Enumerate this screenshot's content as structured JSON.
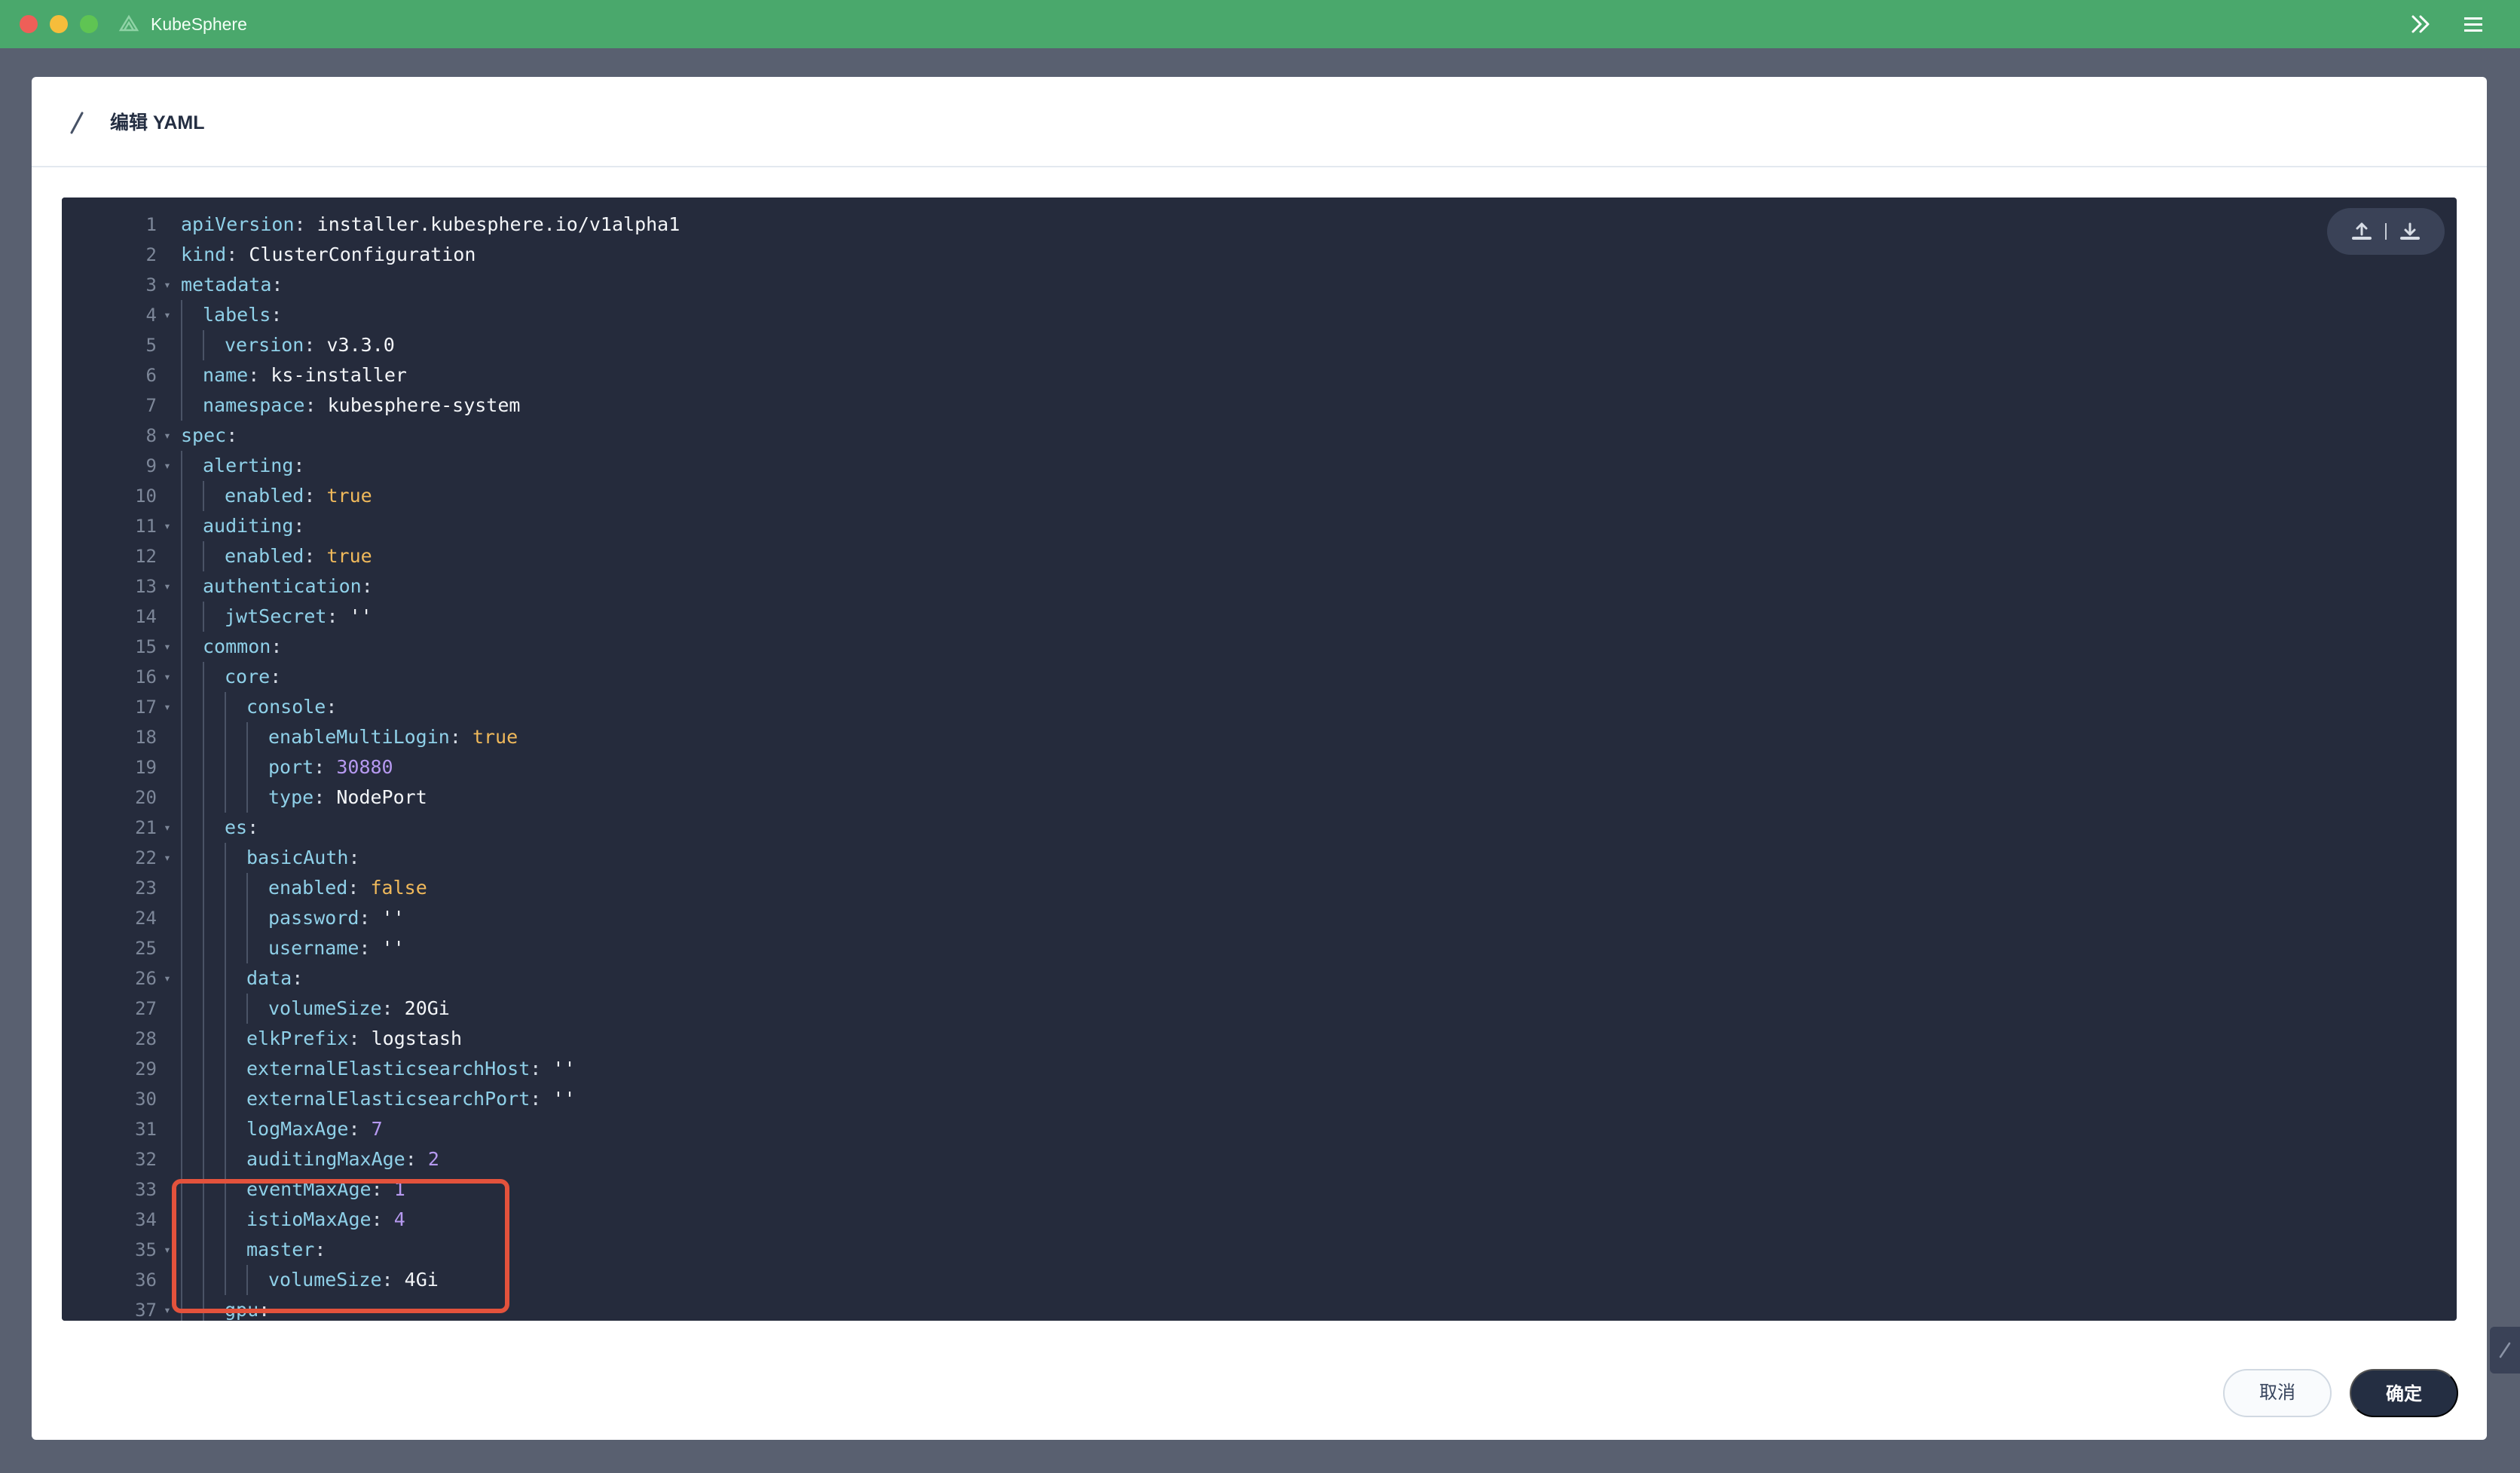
{
  "window": {
    "title": "KubeSphere",
    "accent_color": "#4aa86c"
  },
  "modal": {
    "title": "编辑 YAML",
    "cancel_label": "取消",
    "confirm_label": "确定"
  },
  "editor": {
    "upload_icon": "upload-icon",
    "download_icon": "download-icon",
    "highlight_color": "#e3523c",
    "highlighted_lines": [
      31,
      32,
      33,
      34
    ],
    "lines": [
      {
        "n": "1",
        "fold": false,
        "depth": 0,
        "key": "apiVersion",
        "value": "installer.kubesphere.io/v1alpha1",
        "type": "s"
      },
      {
        "n": "2",
        "fold": false,
        "depth": 0,
        "key": "kind",
        "value": "ClusterConfiguration",
        "type": "s"
      },
      {
        "n": "3",
        "fold": true,
        "depth": 0,
        "key": "metadata",
        "value": "",
        "type": "s"
      },
      {
        "n": "4",
        "fold": true,
        "depth": 1,
        "key": "labels",
        "value": "",
        "type": "s"
      },
      {
        "n": "5",
        "fold": false,
        "depth": 2,
        "key": "version",
        "value": "v3.3.0",
        "type": "s"
      },
      {
        "n": "6",
        "fold": false,
        "depth": 1,
        "key": "name",
        "value": "ks-installer",
        "type": "s"
      },
      {
        "n": "7",
        "fold": false,
        "depth": 1,
        "key": "namespace",
        "value": "kubesphere-system",
        "type": "s"
      },
      {
        "n": "8",
        "fold": true,
        "depth": 0,
        "key": "spec",
        "value": "",
        "type": "s"
      },
      {
        "n": "9",
        "fold": true,
        "depth": 1,
        "key": "alerting",
        "value": "",
        "type": "s"
      },
      {
        "n": "10",
        "fold": false,
        "depth": 2,
        "key": "enabled",
        "value": "true",
        "type": "b"
      },
      {
        "n": "11",
        "fold": true,
        "depth": 1,
        "key": "auditing",
        "value": "",
        "type": "s"
      },
      {
        "n": "12",
        "fold": false,
        "depth": 2,
        "key": "enabled",
        "value": "true",
        "type": "b"
      },
      {
        "n": "13",
        "fold": true,
        "depth": 1,
        "key": "authentication",
        "value": "",
        "type": "s"
      },
      {
        "n": "14",
        "fold": false,
        "depth": 2,
        "key": "jwtSecret",
        "value": "''",
        "type": "s"
      },
      {
        "n": "15",
        "fold": true,
        "depth": 1,
        "key": "common",
        "value": "",
        "type": "s"
      },
      {
        "n": "16",
        "fold": true,
        "depth": 2,
        "key": "core",
        "value": "",
        "type": "s"
      },
      {
        "n": "17",
        "fold": true,
        "depth": 3,
        "key": "console",
        "value": "",
        "type": "s"
      },
      {
        "n": "18",
        "fold": false,
        "depth": 4,
        "key": "enableMultiLogin",
        "value": "true",
        "type": "b"
      },
      {
        "n": "19",
        "fold": false,
        "depth": 4,
        "key": "port",
        "value": "30880",
        "type": "n"
      },
      {
        "n": "20",
        "fold": false,
        "depth": 4,
        "key": "type",
        "value": "NodePort",
        "type": "s"
      },
      {
        "n": "21",
        "fold": true,
        "depth": 2,
        "key": "es",
        "value": "",
        "type": "s"
      },
      {
        "n": "22",
        "fold": true,
        "depth": 3,
        "key": "basicAuth",
        "value": "",
        "type": "s"
      },
      {
        "n": "23",
        "fold": false,
        "depth": 4,
        "key": "enabled",
        "value": "false",
        "type": "b"
      },
      {
        "n": "24",
        "fold": false,
        "depth": 4,
        "key": "password",
        "value": "''",
        "type": "s"
      },
      {
        "n": "25",
        "fold": false,
        "depth": 4,
        "key": "username",
        "value": "''",
        "type": "s"
      },
      {
        "n": "26",
        "fold": true,
        "depth": 3,
        "key": "data",
        "value": "",
        "type": "s"
      },
      {
        "n": "27",
        "fold": false,
        "depth": 4,
        "key": "volumeSize",
        "value": "20Gi",
        "type": "s"
      },
      {
        "n": "28",
        "fold": false,
        "depth": 3,
        "key": "elkPrefix",
        "value": "logstash",
        "type": "s"
      },
      {
        "n": "29",
        "fold": false,
        "depth": 3,
        "key": "externalElasticsearchHost",
        "value": "''",
        "type": "s"
      },
      {
        "n": "30",
        "fold": false,
        "depth": 3,
        "key": "externalElasticsearchPort",
        "value": "''",
        "type": "s"
      },
      {
        "n": "31",
        "fold": false,
        "depth": 3,
        "key": "logMaxAge",
        "value": "7",
        "type": "n"
      },
      {
        "n": "32",
        "fold": false,
        "depth": 3,
        "key": "auditingMaxAge",
        "value": "2",
        "type": "n"
      },
      {
        "n": "33",
        "fold": false,
        "depth": 3,
        "key": "eventMaxAge",
        "value": "1",
        "type": "n"
      },
      {
        "n": "34",
        "fold": false,
        "depth": 3,
        "key": "istioMaxAge",
        "value": "4",
        "type": "n"
      },
      {
        "n": "35",
        "fold": true,
        "depth": 3,
        "key": "master",
        "value": "",
        "type": "s"
      },
      {
        "n": "36",
        "fold": false,
        "depth": 4,
        "key": "volumeSize",
        "value": "4Gi",
        "type": "s"
      },
      {
        "n": "37",
        "fold": true,
        "depth": 2,
        "key": "gpu",
        "value": "",
        "type": "s"
      }
    ]
  }
}
